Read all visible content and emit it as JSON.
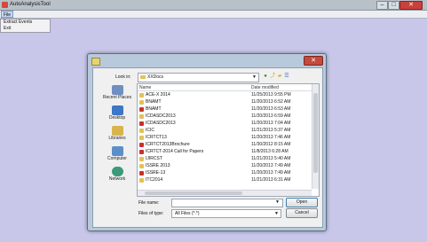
{
  "app": {
    "title": "AutoAnalysisTool"
  },
  "menu": {
    "file_label": "File",
    "items": [
      {
        "label": "Extract Events"
      },
      {
        "label": "Exit"
      }
    ]
  },
  "dialog": {
    "lookin_label": "Look in:",
    "lookin_value": "XXDocs",
    "columns": {
      "name": "Name",
      "date": "Date modified"
    },
    "places": [
      {
        "label": "Recent Places",
        "icon": "recent-places-icon",
        "color": "#6f8fc0"
      },
      {
        "label": "Desktop",
        "icon": "desktop-icon",
        "color": "#3f76c6"
      },
      {
        "label": "Libraries",
        "icon": "libraries-icon",
        "color": "#d8b44a"
      },
      {
        "label": "Computer",
        "icon": "computer-icon",
        "color": "#5c8fc9"
      },
      {
        "label": "Network",
        "icon": "network-icon",
        "color": "#3b9a7a"
      }
    ],
    "files": [
      {
        "name": "ACE-X 2014",
        "date": "11/25/2013 9:55 PM",
        "icon": "folder-icon"
      },
      {
        "name": "BNAMT",
        "date": "11/20/2013 6:52 AM",
        "icon": "folder-icon"
      },
      {
        "name": "BNAMT",
        "date": "11/20/2013 6:53 AM",
        "icon": "pdf-icon"
      },
      {
        "name": "ICDASDC2013",
        "date": "11/20/2013 6:59 AM",
        "icon": "folder-icon"
      },
      {
        "name": "ICDASDC2013",
        "date": "11/20/2013 7:04 AM",
        "icon": "pdf-icon"
      },
      {
        "name": "ICIC",
        "date": "11/21/2013 5:37 AM",
        "icon": "folder-icon"
      },
      {
        "name": "ICRTCT13",
        "date": "11/20/2013 7:46 AM",
        "icon": "folder-icon"
      },
      {
        "name": "ICRTCT2013Brochure",
        "date": "11/30/2012 8:15 AM",
        "icon": "pdf-icon"
      },
      {
        "name": "ICRTCT-2014 Call for Papers",
        "date": "11/8/2013 6:28 AM",
        "icon": "pdf-icon"
      },
      {
        "name": "IJIRCST",
        "date": "11/21/2013 5:40 AM",
        "icon": "folder-icon"
      },
      {
        "name": "ISSRE 2013",
        "date": "11/20/2013 7:49 AM",
        "icon": "folder-icon"
      },
      {
        "name": "ISSRE-13",
        "date": "11/20/2013 7:49 AM",
        "icon": "pdf-icon"
      },
      {
        "name": "ITC2014",
        "date": "11/21/2013 6:31 AM",
        "icon": "folder-icon"
      }
    ],
    "filename_label": "File name:",
    "filename_value": "",
    "filetype_label": "Files of type:",
    "filetype_value": "All Files (*.*)",
    "open_label": "Open",
    "cancel_label": "Cancel"
  },
  "colors": {
    "desktop_bg": "#c8c7ea",
    "folder": "#e2c15a",
    "pdf": "#c9302c"
  }
}
